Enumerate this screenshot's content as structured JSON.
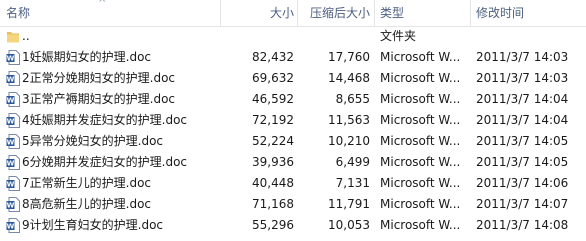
{
  "columns": {
    "name": "名称",
    "size": "大小",
    "compressed": "压缩后大小",
    "type": "类型",
    "modified": "修改时间"
  },
  "rows": [
    {
      "name": "..",
      "size": "",
      "compressed": "",
      "type": "文件夹",
      "modified": "",
      "icon": "folder-icon"
    },
    {
      "name": "1妊娠期妇女的护理.doc",
      "size": "82,432",
      "compressed": "17,760",
      "type": "Microsoft W...",
      "modified": "2011/3/7 14:03",
      "icon": "word-doc-icon"
    },
    {
      "name": "2正常分娩期妇女的护理.doc",
      "size": "69,632",
      "compressed": "14,468",
      "type": "Microsoft W...",
      "modified": "2011/3/7 14:03",
      "icon": "word-doc-icon"
    },
    {
      "name": "3正常产褥期妇女的护理.doc",
      "size": "46,592",
      "compressed": "8,655",
      "type": "Microsoft W...",
      "modified": "2011/3/7 14:04",
      "icon": "word-doc-icon"
    },
    {
      "name": "4妊娠期并发症妇女的护理.doc",
      "size": "72,192",
      "compressed": "11,563",
      "type": "Microsoft W...",
      "modified": "2011/3/7 14:04",
      "icon": "word-doc-icon"
    },
    {
      "name": "5异常分娩妇女的护理.doc",
      "size": "52,224",
      "compressed": "10,210",
      "type": "Microsoft W...",
      "modified": "2011/3/7 14:05",
      "icon": "word-doc-icon"
    },
    {
      "name": "6分娩期并发症妇女的护理.doc",
      "size": "39,936",
      "compressed": "6,499",
      "type": "Microsoft W...",
      "modified": "2011/3/7 14:05",
      "icon": "word-doc-icon"
    },
    {
      "name": "7正常新生儿的护理.doc",
      "size": "40,448",
      "compressed": "7,131",
      "type": "Microsoft W...",
      "modified": "2011/3/7 14:06",
      "icon": "word-doc-icon"
    },
    {
      "name": "8高危新生儿的护理.doc",
      "size": "71,168",
      "compressed": "11,791",
      "type": "Microsoft W...",
      "modified": "2011/3/7 14:07",
      "icon": "word-doc-icon"
    },
    {
      "name": "9计划生育妇女的护理.doc",
      "size": "55,296",
      "compressed": "10,053",
      "type": "Microsoft W...",
      "modified": "2011/3/7 14:08",
      "icon": "word-doc-icon"
    }
  ],
  "colors": {
    "header_text": "#4d6082",
    "folder": "#e8c15c",
    "word_blue": "#2b5797"
  }
}
